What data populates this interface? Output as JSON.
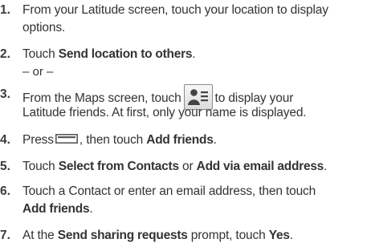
{
  "steps": [
    {
      "number": "1.",
      "lines": [
        "From your Latitude screen, touch your location to display",
        "options."
      ]
    },
    {
      "number": "2.",
      "pre": "Touch ",
      "bold": "Send location to others",
      "post": "."
    },
    {
      "or_text": "– or –"
    },
    {
      "number": "3.",
      "pre": "From the Maps screen, touch",
      "icon": "latitude-friends-icon",
      "post": "to display your",
      "line2": "Latitude friends. At first, only your name is displayed."
    },
    {
      "number": "4.",
      "pre": "Press",
      "icon": "menu-key-icon",
      "post_a": ", then touch ",
      "bold": "Add friends",
      "post_b": "."
    },
    {
      "number": "5.",
      "pre": "Touch ",
      "bold_a": "Select from Contacts",
      "mid": " or ",
      "bold_b": "Add via email address",
      "post": "."
    },
    {
      "number": "6.",
      "line1": "Touch a Contact or enter an email address, then touch",
      "bold": "Add friends",
      "post": "."
    },
    {
      "number": "7.",
      "pre": "At the ",
      "bold_a": "Send sharing requests",
      "mid": " prompt, touch ",
      "bold_b": "Yes",
      "post": "."
    }
  ],
  "colors": {
    "text": "#333333",
    "icon_border": "#8a8a8a",
    "icon_fill": "#4a4a4a"
  }
}
